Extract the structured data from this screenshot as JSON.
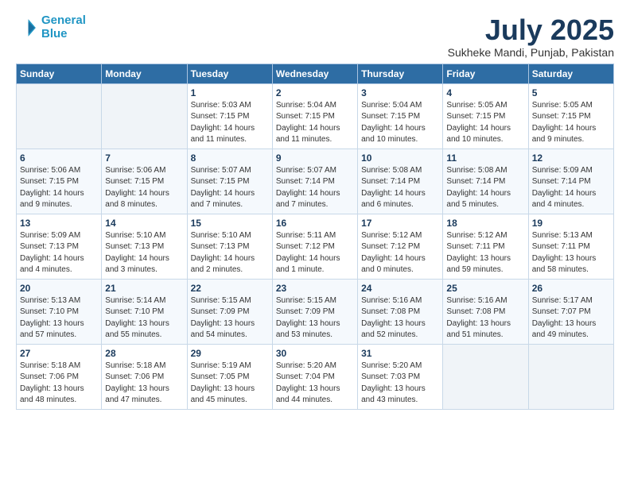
{
  "logo": {
    "line1": "General",
    "line2": "Blue"
  },
  "title": "July 2025",
  "subtitle": "Sukheke Mandi, Punjab, Pakistan",
  "days_of_week": [
    "Sunday",
    "Monday",
    "Tuesday",
    "Wednesday",
    "Thursday",
    "Friday",
    "Saturday"
  ],
  "weeks": [
    [
      {
        "day": "",
        "info": ""
      },
      {
        "day": "",
        "info": ""
      },
      {
        "day": "1",
        "info": "Sunrise: 5:03 AM\nSunset: 7:15 PM\nDaylight: 14 hours\nand 11 minutes."
      },
      {
        "day": "2",
        "info": "Sunrise: 5:04 AM\nSunset: 7:15 PM\nDaylight: 14 hours\nand 11 minutes."
      },
      {
        "day": "3",
        "info": "Sunrise: 5:04 AM\nSunset: 7:15 PM\nDaylight: 14 hours\nand 10 minutes."
      },
      {
        "day": "4",
        "info": "Sunrise: 5:05 AM\nSunset: 7:15 PM\nDaylight: 14 hours\nand 10 minutes."
      },
      {
        "day": "5",
        "info": "Sunrise: 5:05 AM\nSunset: 7:15 PM\nDaylight: 14 hours\nand 9 minutes."
      }
    ],
    [
      {
        "day": "6",
        "info": "Sunrise: 5:06 AM\nSunset: 7:15 PM\nDaylight: 14 hours\nand 9 minutes."
      },
      {
        "day": "7",
        "info": "Sunrise: 5:06 AM\nSunset: 7:15 PM\nDaylight: 14 hours\nand 8 minutes."
      },
      {
        "day": "8",
        "info": "Sunrise: 5:07 AM\nSunset: 7:15 PM\nDaylight: 14 hours\nand 7 minutes."
      },
      {
        "day": "9",
        "info": "Sunrise: 5:07 AM\nSunset: 7:14 PM\nDaylight: 14 hours\nand 7 minutes."
      },
      {
        "day": "10",
        "info": "Sunrise: 5:08 AM\nSunset: 7:14 PM\nDaylight: 14 hours\nand 6 minutes."
      },
      {
        "day": "11",
        "info": "Sunrise: 5:08 AM\nSunset: 7:14 PM\nDaylight: 14 hours\nand 5 minutes."
      },
      {
        "day": "12",
        "info": "Sunrise: 5:09 AM\nSunset: 7:14 PM\nDaylight: 14 hours\nand 4 minutes."
      }
    ],
    [
      {
        "day": "13",
        "info": "Sunrise: 5:09 AM\nSunset: 7:13 PM\nDaylight: 14 hours\nand 4 minutes."
      },
      {
        "day": "14",
        "info": "Sunrise: 5:10 AM\nSunset: 7:13 PM\nDaylight: 14 hours\nand 3 minutes."
      },
      {
        "day": "15",
        "info": "Sunrise: 5:10 AM\nSunset: 7:13 PM\nDaylight: 14 hours\nand 2 minutes."
      },
      {
        "day": "16",
        "info": "Sunrise: 5:11 AM\nSunset: 7:12 PM\nDaylight: 14 hours\nand 1 minute."
      },
      {
        "day": "17",
        "info": "Sunrise: 5:12 AM\nSunset: 7:12 PM\nDaylight: 14 hours\nand 0 minutes."
      },
      {
        "day": "18",
        "info": "Sunrise: 5:12 AM\nSunset: 7:11 PM\nDaylight: 13 hours\nand 59 minutes."
      },
      {
        "day": "19",
        "info": "Sunrise: 5:13 AM\nSunset: 7:11 PM\nDaylight: 13 hours\nand 58 minutes."
      }
    ],
    [
      {
        "day": "20",
        "info": "Sunrise: 5:13 AM\nSunset: 7:10 PM\nDaylight: 13 hours\nand 57 minutes."
      },
      {
        "day": "21",
        "info": "Sunrise: 5:14 AM\nSunset: 7:10 PM\nDaylight: 13 hours\nand 55 minutes."
      },
      {
        "day": "22",
        "info": "Sunrise: 5:15 AM\nSunset: 7:09 PM\nDaylight: 13 hours\nand 54 minutes."
      },
      {
        "day": "23",
        "info": "Sunrise: 5:15 AM\nSunset: 7:09 PM\nDaylight: 13 hours\nand 53 minutes."
      },
      {
        "day": "24",
        "info": "Sunrise: 5:16 AM\nSunset: 7:08 PM\nDaylight: 13 hours\nand 52 minutes."
      },
      {
        "day": "25",
        "info": "Sunrise: 5:16 AM\nSunset: 7:08 PM\nDaylight: 13 hours\nand 51 minutes."
      },
      {
        "day": "26",
        "info": "Sunrise: 5:17 AM\nSunset: 7:07 PM\nDaylight: 13 hours\nand 49 minutes."
      }
    ],
    [
      {
        "day": "27",
        "info": "Sunrise: 5:18 AM\nSunset: 7:06 PM\nDaylight: 13 hours\nand 48 minutes."
      },
      {
        "day": "28",
        "info": "Sunrise: 5:18 AM\nSunset: 7:06 PM\nDaylight: 13 hours\nand 47 minutes."
      },
      {
        "day": "29",
        "info": "Sunrise: 5:19 AM\nSunset: 7:05 PM\nDaylight: 13 hours\nand 45 minutes."
      },
      {
        "day": "30",
        "info": "Sunrise: 5:20 AM\nSunset: 7:04 PM\nDaylight: 13 hours\nand 44 minutes."
      },
      {
        "day": "31",
        "info": "Sunrise: 5:20 AM\nSunset: 7:03 PM\nDaylight: 13 hours\nand 43 minutes."
      },
      {
        "day": "",
        "info": ""
      },
      {
        "day": "",
        "info": ""
      }
    ]
  ]
}
